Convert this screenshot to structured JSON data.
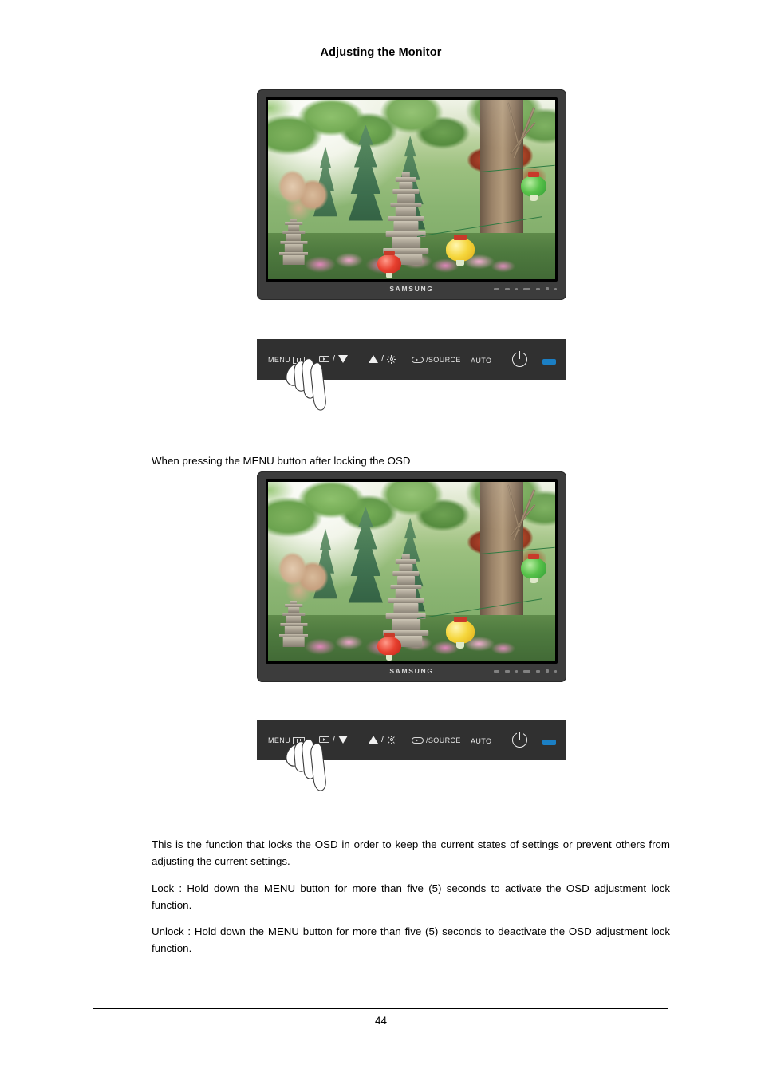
{
  "document": {
    "header_title": "Adjusting the Monitor",
    "page_number": "44"
  },
  "caption": {
    "text": "When pressing the MENU button after locking the OSD"
  },
  "monitor": {
    "brand": "SAMSUNG",
    "screen_description": "Garden photograph with stone pagodas, green conifers, a large tree trunk and hanging paper lanterns"
  },
  "control_bar": {
    "buttons": [
      {
        "label": "MENU",
        "icon": "menu-icon"
      },
      {
        "label": "",
        "icon": "enter-icon",
        "separator": "/",
        "secondary_icon": "triangle-down-icon"
      },
      {
        "label": "",
        "icon": "triangle-up-icon",
        "separator": "/",
        "secondary_icon": "brightness-icon"
      },
      {
        "label": "/SOURCE",
        "icon": "enter-oval-icon"
      },
      {
        "label": "AUTO",
        "icon": ""
      },
      {
        "label": "",
        "icon": "power-icon"
      },
      {
        "label": "",
        "icon": "power-led-indicator"
      }
    ],
    "menu_label": "MENU",
    "source_label": "/SOURCE",
    "auto_label": "AUTO",
    "slash": "/",
    "hand_hint": "hand pressing the MENU button"
  },
  "body": {
    "paragraph_1": "This is the function that locks the OSD in order to keep the current states of settings or prevent others from adjusting the current settings.",
    "paragraph_2": "Lock : Hold down the MENU button for more than five (5) seconds to activate the OSD adjustment lock function.",
    "paragraph_3": "Unlock : Hold down the MENU button for more than five (5) seconds to deactivate the OSD adjustment lock function."
  },
  "colors": {
    "led_blue": "#1b7fc4",
    "bezel_gray": "#3c3c3c",
    "control_bar_gray": "#303030",
    "text_black": "#000000"
  }
}
